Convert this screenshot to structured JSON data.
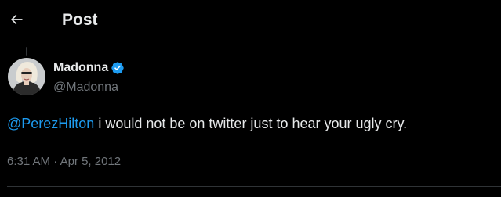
{
  "header": {
    "title": "Post",
    "back_icon": "arrow-left-icon"
  },
  "author": {
    "name": "Madonna",
    "handle": "@Madonna",
    "verified_icon": "verified-badge-icon",
    "verified_color": "#1d9bf0"
  },
  "tweet": {
    "mention": "@PerezHilton",
    "text": " i would not be on twitter just to hear your ugly cry."
  },
  "meta": {
    "time": "6:31 AM",
    "separator": " · ",
    "date": "Apr 5, 2012"
  },
  "colors": {
    "background": "#000000",
    "text_primary": "#e7e9ea",
    "text_secondary": "#71767b",
    "link": "#1d9bf0",
    "divider": "#2f3336"
  }
}
